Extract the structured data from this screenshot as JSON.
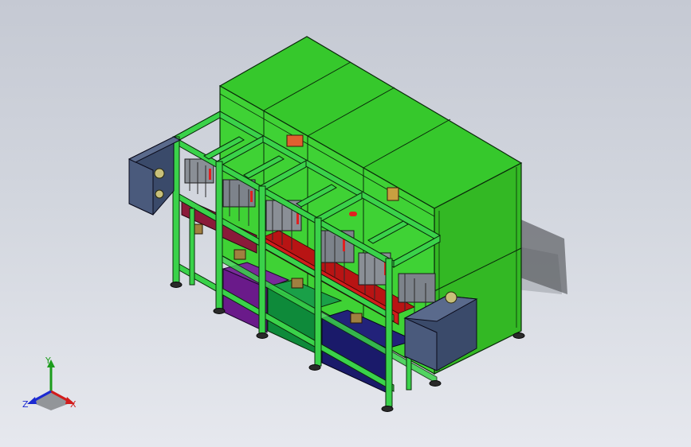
{
  "viewport": {
    "background_top": "#c5c9d3",
    "background_bottom": "#e6e8ee"
  },
  "model": {
    "frame_color": "#3ad24a",
    "enclosure_color": "#36c82c",
    "edge_color": "#0a2a0a",
    "end_box_color": "#3a4a6a",
    "bin_colors": [
      "#6a1a8a",
      "#0e8a3a",
      "#1a1a6a"
    ],
    "rail_color": "#d21c1c"
  },
  "triad": {
    "x_label": "X",
    "y_label": "Y",
    "z_label": "Z",
    "x_color": "#d21c1c",
    "y_color": "#1c9c1c",
    "z_color": "#1c2ad2"
  }
}
